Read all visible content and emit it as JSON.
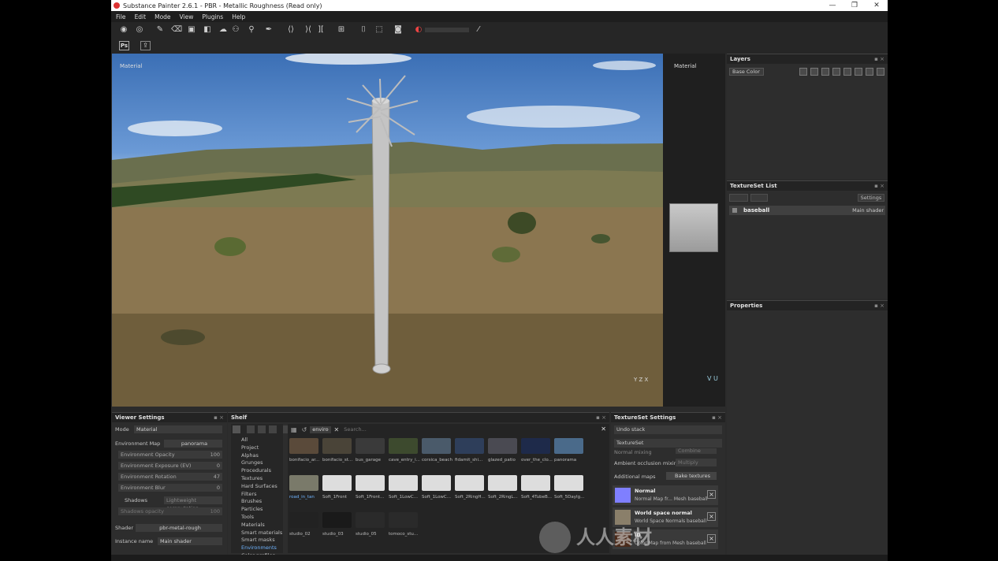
{
  "window": {
    "title": "Substance Painter 2.6.1 - PBR - Metallic Roughness (Read only)",
    "controls": [
      "—",
      "❐",
      "✕"
    ]
  },
  "menu": [
    "File",
    "Edit",
    "Mode",
    "View",
    "Plugins",
    "Help"
  ],
  "toolbar": {
    "ps_label": "Ps"
  },
  "viewport": {
    "label_3d": "Material",
    "label_2d": "Material",
    "axis_3d": "Y Z X",
    "axis_2d": "V U"
  },
  "layers": {
    "title": "Layers",
    "channel": "Base Color"
  },
  "texture_set_list": {
    "title": "TextureSet List",
    "settings_button": "Settings",
    "item": {
      "name": "baseball",
      "shader": "Main shader"
    }
  },
  "properties": {
    "title": "Properties"
  },
  "viewer_settings": {
    "title": "Viewer Settings",
    "mode_label": "Mode",
    "mode_value": "Material",
    "env_map_label": "Environment Map",
    "env_map_value": "panorama",
    "sliders": [
      {
        "label": "Environment Opacity",
        "value": "100"
      },
      {
        "label": "Environment Exposure (EV)",
        "value": "0"
      },
      {
        "label": "Environment Rotation",
        "value": "47"
      },
      {
        "label": "Environment Blur",
        "value": "0"
      }
    ],
    "shadows_label": "Shadows",
    "shadows_value": "Lightweight computation",
    "shadows_opacity_label": "Shadows opacity",
    "shadows_opacity_value": "100",
    "shader_label": "Shader",
    "shader_value": "pbr-metal-rough",
    "instance_label": "Instance name",
    "instance_value": "Main shader"
  },
  "shelf": {
    "title": "Shelf",
    "categories": [
      "All",
      "Project",
      "Alphas",
      "Grunges",
      "Procedurals",
      "Textures",
      "Hard Surfaces",
      "Filters",
      "Brushes",
      "Particles",
      "Tools",
      "Materials",
      "Smart materials",
      "Smart masks",
      "Environments",
      "Color profiles"
    ],
    "active_category": "Environments",
    "filter_chip": "enviro",
    "search_placeholder": "Search...",
    "items": [
      {
        "label": "bonifacio_ar...",
        "color": "#5a4a3a"
      },
      {
        "label": "bonifacio_st...",
        "color": "#4a4438"
      },
      {
        "label": "bus_garage",
        "color": "#3a3a3a"
      },
      {
        "label": "cave_entry_i...",
        "color": "#3d4a2e"
      },
      {
        "label": "corsica_beach",
        "color": "#4a5a6a"
      },
      {
        "label": "fidamit_shi...",
        "color": "#2e3e5a"
      },
      {
        "label": "glazed_patio",
        "color": "#4a4a52"
      },
      {
        "label": "over_the_clo...",
        "color": "#1e2a4a"
      },
      {
        "label": "panorama",
        "color": "#4a6a8a"
      },
      {
        "label": "road_in_tan",
        "color": "#7a7a6a"
      },
      {
        "label": "Soft_1Front",
        "color": "#dddddd"
      },
      {
        "label": "Soft_1Front...",
        "color": "#dddddd"
      },
      {
        "label": "Soft_1LowC...",
        "color": "#dddddd"
      },
      {
        "label": "Soft_1LowC...",
        "color": "#dddddd"
      },
      {
        "label": "Soft_2RingH...",
        "color": "#dddddd"
      },
      {
        "label": "Soft_2RingL...",
        "color": "#dddddd"
      },
      {
        "label": "Soft_4TubeB...",
        "color": "#dddddd"
      },
      {
        "label": "Soft_5DayIg...",
        "color": "#dddddd"
      },
      {
        "label": "studio_02",
        "color": "#222222"
      },
      {
        "label": "studio_03",
        "color": "#1a1a1a"
      },
      {
        "label": "studio_05",
        "color": "#2a2a2a"
      },
      {
        "label": "tomoco_stu...",
        "color": "#2a2a2a"
      }
    ],
    "selected_item": "road_in_tan"
  },
  "textureset_settings": {
    "title": "TextureSet Settings",
    "undo_stack": "Undo stack",
    "textureset": "TextureSet",
    "normal_mixing_label": "Normal mixing",
    "normal_mixing_value": "Combine",
    "ao_mixing_label": "Ambient occlusion mixing",
    "ao_mixing_value": "Multiply",
    "additional_maps_label": "Additional maps",
    "bake_button": "Bake textures",
    "maps": [
      {
        "name": "Normal",
        "desc": "Normal Map fr... Mesh baseball",
        "color": "#7f7fff"
      },
      {
        "name": "World space normal",
        "desc": "World Space Normals baseball",
        "color": "#8a7f6a"
      },
      {
        "name": "ID",
        "desc": "Color Map from Mesh baseball",
        "color": "#4a2a1a"
      }
    ]
  },
  "watermark": "人人素材"
}
